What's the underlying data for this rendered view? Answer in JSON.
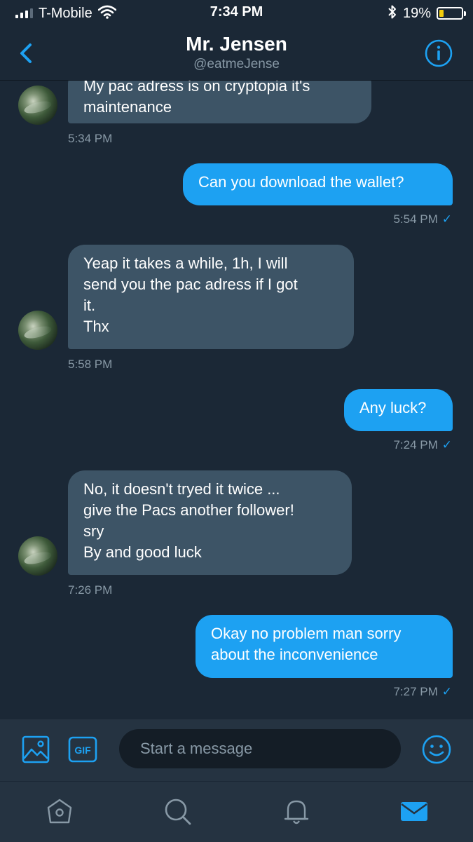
{
  "status_bar": {
    "carrier": "T-Mobile",
    "time": "7:34 PM",
    "battery_percent": "19%",
    "battery_level": 0.19,
    "signal_bars": 3,
    "signal_max": 4,
    "icons": [
      "wifi-icon",
      "bluetooth-icon",
      "battery-icon"
    ]
  },
  "header": {
    "title": "Mr. Jensen",
    "handle": "@eatmeJense",
    "back_icon": "chevron-left-icon",
    "info_icon": "info-icon",
    "accent": "#1da1f2"
  },
  "messages": [
    {
      "direction": "in",
      "text": "My pac adress is on cryptopia it's\nmaintenance",
      "time": "5:34 PM"
    },
    {
      "direction": "out",
      "text": "Can you download the wallet?",
      "time": "5:54 PM"
    },
    {
      "direction": "in",
      "text": "Yeap it takes a while, 1h, I will\nsend you the pac adress if I got\nit.\nThx",
      "time": "5:58 PM"
    },
    {
      "direction": "out",
      "text": "Any luck?",
      "time": "7:24 PM"
    },
    {
      "direction": "in",
      "text": "No, it doesn't tryed it twice ...\ngive the Pacs another follower!\nsry\nBy and good luck",
      "time": "7:26 PM"
    },
    {
      "direction": "out",
      "text": "Okay no problem man sorry\nabout the inconvenience",
      "time": "7:27 PM"
    }
  ],
  "composer": {
    "placeholder": "Start a message",
    "gif_label": "GIF",
    "photo_icon": "image-icon",
    "emoji_icon": "emoji-icon"
  },
  "tabs": [
    {
      "name": "home",
      "icon": "home-icon"
    },
    {
      "name": "search",
      "icon": "search-icon"
    },
    {
      "name": "notifications",
      "icon": "bell-icon"
    },
    {
      "name": "messages",
      "icon": "mail-icon",
      "active": true
    }
  ],
  "colors": {
    "background": "#1b2836",
    "incoming_bubble": "#3d5466",
    "outgoing_bubble": "#1da1f2",
    "bar": "#253341",
    "muted_text": "#8899a6"
  }
}
